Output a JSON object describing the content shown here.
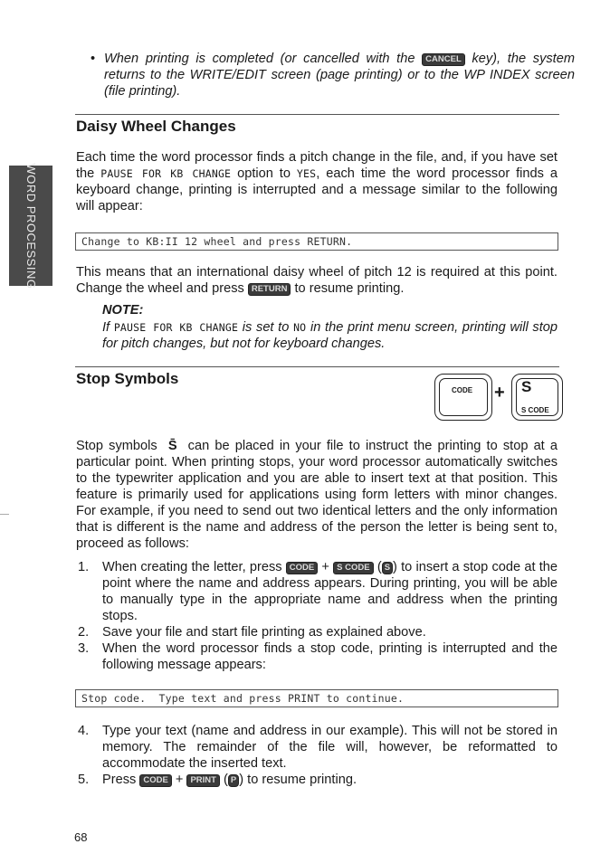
{
  "side_tab": "WORD PROCESSING",
  "bullet": {
    "before": "When printing is completed (or cancelled with the ",
    "key": "CANCEL",
    "after": " key), the system returns to the WRITE/EDIT screen (page printing) or to the WP INDEX screen (file printing)."
  },
  "daisy": {
    "heading": "Daisy Wheel Changes",
    "p1": {
      "a": "Each time the word processor finds a pitch change in the file, and, if you have set the ",
      "code1": "PAUSE FOR KB CHANGE",
      "b": " option to ",
      "code2": "YES",
      "c": ", each time the word processor finds a keyboard change, printing is interrupted and a message similar to the following will appear:"
    },
    "message": "Change to KB:II 12 wheel and press RETURN.",
    "p2": {
      "a": "This means that an international daisy wheel of pitch 12 is required at this point. Change the wheel and press ",
      "key": "RETURN",
      "b": " to resume printing."
    },
    "note_label": "NOTE:",
    "note": {
      "a": "If ",
      "code1": "PAUSE FOR KB CHANGE",
      "b": " is set to ",
      "code2": "NO",
      "c": " in the print menu screen, printing will stop for pitch changes, but not for keyboard changes."
    }
  },
  "stop": {
    "heading": "Stop Symbols",
    "keycaps": {
      "key1": "CODE",
      "plus": "+",
      "key2_big": "S",
      "key2_small": "S CODE"
    },
    "p1": {
      "a": "Stop symbols ",
      "symbol": "S̄",
      "b": " can be placed in your file to instruct the printing to stop at a particular point. When printing stops, your word processor automatically switches to the typewriter application and you are able to insert text at that position. This feature is primarily used for applications using form letters with minor changes. For example, if you need to send out two identical letters and the only information that is different is the name and address of the person the letter is being sent to, proceed as follows:"
    },
    "steps": [
      {
        "num": "1.",
        "a": "When creating the letter, press ",
        "k1": "CODE",
        "plus": " + ",
        "k2": "S CODE",
        "paren_open": " (",
        "k3": "S",
        "b": ") to insert a stop code at the point where the name and address appears. During printing, you will be able to manually type in the appropriate name and address when the printing stops."
      },
      {
        "num": "2.",
        "text": "Save your file and start file printing as explained above."
      },
      {
        "num": "3.",
        "text": "When the word processor finds a stop code, printing is interrupted and the following message appears:"
      }
    ],
    "message": "Stop code.  Type text and press PRINT to continue.",
    "steps2": [
      {
        "num": "4.",
        "text": "Type your text (name and address in our example). This will not be stored in memory. The remainder of the file will, however, be reformatted to accommodate the inserted text."
      },
      {
        "num": "5.",
        "a": "Press ",
        "k1": "CODE",
        "plus": " + ",
        "k2": "PRINT",
        "paren_open": " (",
        "k3": "P",
        "b": ") to resume printing."
      }
    ]
  },
  "page_number": "68"
}
